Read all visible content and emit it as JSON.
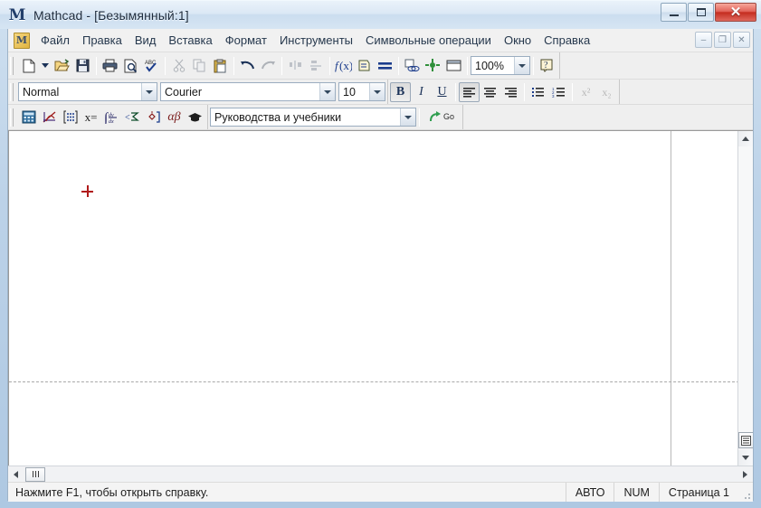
{
  "window": {
    "logo_letter": "M",
    "title": "Mathcad - [Безымянный:1]",
    "controls": {
      "minimize": "–",
      "maximize": "□",
      "close": "✕"
    }
  },
  "menu": {
    "doc_icon_letter": "M",
    "items": [
      {
        "label": "Файл"
      },
      {
        "label": "Правка"
      },
      {
        "label": "Вид"
      },
      {
        "label": "Вставка"
      },
      {
        "label": "Формат"
      },
      {
        "label": "Инструменты"
      },
      {
        "label": "Символьные операции"
      },
      {
        "label": "Окно"
      },
      {
        "label": "Справка"
      }
    ],
    "mdi": {
      "minimize": "–",
      "restore": "❐",
      "close": "✕"
    }
  },
  "standard_toolbar": {
    "buttons": [
      {
        "name": "new-document",
        "title": "Создать"
      },
      {
        "name": "new-dropdown",
        "title": "Создать (список)"
      },
      {
        "name": "open-file",
        "title": "Открыть"
      },
      {
        "name": "save-file",
        "title": "Сохранить"
      },
      {
        "name": "print",
        "title": "Печать"
      },
      {
        "name": "print-preview",
        "title": "Предварительный просмотр"
      },
      {
        "name": "spell-check",
        "title": "Проверка орфографии"
      },
      {
        "name": "cut",
        "title": "Вырезать"
      },
      {
        "name": "copy",
        "title": "Копировать"
      },
      {
        "name": "paste",
        "title": "Вставить"
      },
      {
        "name": "undo",
        "title": "Отменить"
      },
      {
        "name": "redo",
        "title": "Вернуть"
      },
      {
        "name": "align-across",
        "title": "Выровнять по горизонтали"
      },
      {
        "name": "align-down",
        "title": "Выровнять по вертикали"
      },
      {
        "name": "insert-function",
        "title": "Вставить функцию"
      },
      {
        "name": "insert-unit",
        "title": "Вставить единицу"
      },
      {
        "name": "calculate",
        "title": "Вычислить"
      },
      {
        "name": "insert-hyperlink",
        "title": "Вставить гиперссылку"
      },
      {
        "name": "insert-component",
        "title": "Вставить компонент"
      },
      {
        "name": "insert-area",
        "title": "Вставить область"
      },
      {
        "name": "help",
        "title": "Справка"
      }
    ],
    "zoom_value": "100%"
  },
  "format_toolbar": {
    "style_value": "Normal",
    "font_value": "Courier",
    "size_value": "10",
    "bold": "B",
    "italic": "I",
    "underline": "U",
    "buttons": [
      {
        "name": "align-left"
      },
      {
        "name": "align-center"
      },
      {
        "name": "align-right"
      },
      {
        "name": "bulleted-list"
      },
      {
        "name": "numbered-list"
      },
      {
        "name": "superscript",
        "label": "x²"
      },
      {
        "name": "subscript",
        "label": "x₂"
      }
    ]
  },
  "math_toolbar": {
    "buttons": [
      {
        "name": "calculator-palette",
        "title": "Калькулятор"
      },
      {
        "name": "graph-palette",
        "title": "График"
      },
      {
        "name": "matrix-palette",
        "title": "Матрица"
      },
      {
        "name": "evaluation-palette",
        "title": "Вычисление",
        "label": "x="
      },
      {
        "name": "calculus-palette",
        "title": "Матанализ"
      },
      {
        "name": "boolean-palette",
        "title": "Булева алгебра"
      },
      {
        "name": "programming-palette",
        "title": "Программирование"
      },
      {
        "name": "greek-palette",
        "title": "Греческие символы",
        "label": "αβ"
      },
      {
        "name": "symbolic-palette",
        "title": "Символьные операции"
      }
    ],
    "resource_value": "Руководства и учебники",
    "go_label": "Go"
  },
  "document": {
    "cursor": "+"
  },
  "statusbar": {
    "message": "Нажмите F1, чтобы открыть справку.",
    "auto": "АВТО",
    "num": "NUM",
    "page": "Страница 1"
  }
}
